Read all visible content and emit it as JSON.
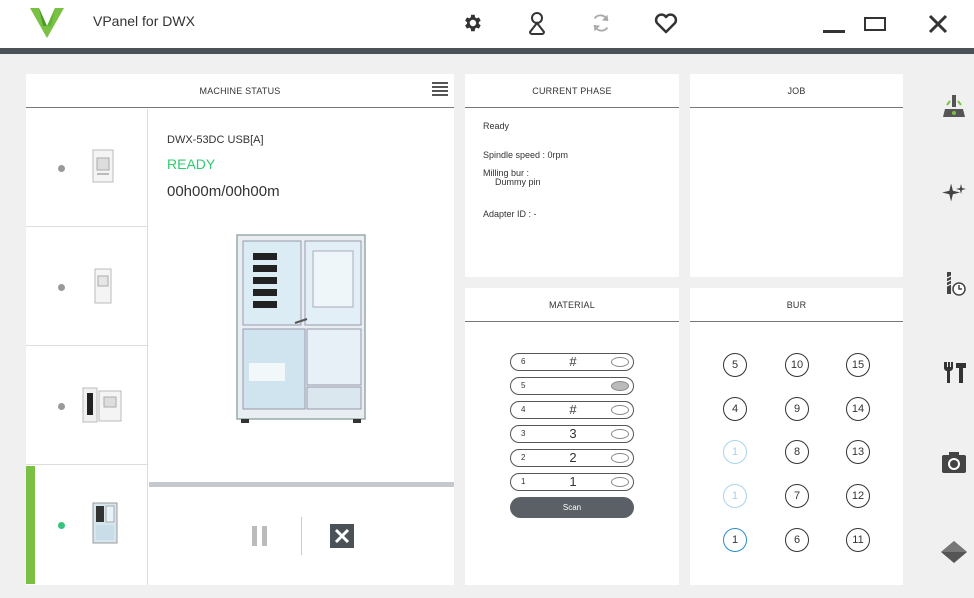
{
  "app": {
    "title": "VPanel for DWX"
  },
  "toolbar": {
    "icons": [
      "gear-icon",
      "person-icon",
      "refresh-icon",
      "heart-icon"
    ]
  },
  "window": {
    "controls": [
      "minimize-icon",
      "maximize-icon",
      "close-icon"
    ]
  },
  "machine_status": {
    "header": "MACHINE STATUS",
    "model": "DWX-53DC USB[A]",
    "state": "READY",
    "time": "00h00m/00h00m",
    "machines": [
      {
        "status": "idle"
      },
      {
        "status": "idle"
      },
      {
        "status": "idle"
      },
      {
        "status": "active",
        "selected": true
      }
    ]
  },
  "current_phase": {
    "header": "CURRENT PHASE",
    "ready": "Ready",
    "spindle": "Spindle speed : 0rpm",
    "milling_bur_label": "Milling bur :",
    "milling_bur_value": "Dummy pin",
    "adapter": "Adapter ID : -"
  },
  "job": {
    "header": "JOB"
  },
  "material": {
    "header": "MATERIAL",
    "rows": [
      {
        "num": "6",
        "val": "#",
        "filled": false
      },
      {
        "num": "5",
        "val": "",
        "filled": true
      },
      {
        "num": "4",
        "val": "#",
        "filled": false
      },
      {
        "num": "3",
        "val": "3",
        "filled": false
      },
      {
        "num": "2",
        "val": "2",
        "filled": false
      },
      {
        "num": "1",
        "val": "1",
        "filled": false
      }
    ],
    "scan_label": "Scan"
  },
  "bur": {
    "header": "BUR",
    "columns": [
      [
        "5",
        "4",
        "1",
        "1",
        "1"
      ],
      [
        "10",
        "9",
        "8",
        "7",
        "6"
      ],
      [
        "15",
        "14",
        "13",
        "12",
        "11"
      ]
    ]
  },
  "sidebar": {
    "icons": [
      "milling-icon",
      "sparkle-icon",
      "bur-timer-icon",
      "tools-icon",
      "camera-icon",
      "diamond-icon"
    ]
  },
  "colors": {
    "ready": "#2ecc71",
    "selected": "#7ac143",
    "active_dot": "#34c47c",
    "bur_highlight": "#2a8dc8",
    "bur_light": "#a8d4ec"
  }
}
